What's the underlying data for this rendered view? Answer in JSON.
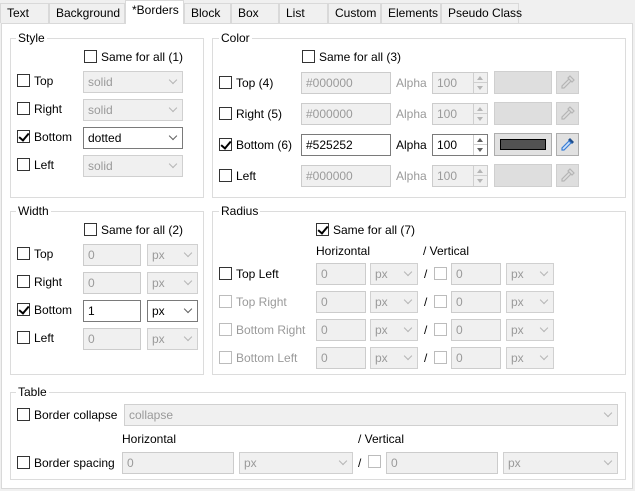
{
  "tabs": [
    "Text",
    "Background",
    "*Borders",
    "Block",
    "Box",
    "List",
    "Custom",
    "Elements",
    "Pseudo Class"
  ],
  "style": {
    "title": "Style",
    "same_for_all": "Same for all (1)",
    "rows": [
      {
        "label": "Top",
        "checked": false,
        "value": "solid",
        "enabled": false
      },
      {
        "label": "Right",
        "checked": false,
        "value": "solid",
        "enabled": false
      },
      {
        "label": "Bottom",
        "checked": true,
        "value": "dotted",
        "enabled": true
      },
      {
        "label": "Left",
        "checked": false,
        "value": "solid",
        "enabled": false
      }
    ]
  },
  "color": {
    "title": "Color",
    "same_for_all": "Same for all (3)",
    "alpha_label": "Alpha",
    "rows": [
      {
        "label": "Top (4)",
        "checked": false,
        "value": "#000000",
        "alpha": "100",
        "enabled": false
      },
      {
        "label": "Right (5)",
        "checked": false,
        "value": "#000000",
        "alpha": "100",
        "enabled": false
      },
      {
        "label": "Bottom (6)",
        "checked": true,
        "value": "#525252",
        "alpha": "100",
        "enabled": true
      },
      {
        "label": "Left",
        "checked": false,
        "value": "#000000",
        "alpha": "100",
        "enabled": false
      }
    ]
  },
  "width": {
    "title": "Width",
    "same_for_all": "Same for all (2)",
    "rows": [
      {
        "label": "Top",
        "checked": false,
        "value": "0",
        "unit": "px",
        "enabled": false
      },
      {
        "label": "Right",
        "checked": false,
        "value": "0",
        "unit": "px",
        "enabled": false
      },
      {
        "label": "Bottom",
        "checked": true,
        "value": "1",
        "unit": "px",
        "enabled": true
      },
      {
        "label": "Left",
        "checked": false,
        "value": "0",
        "unit": "px",
        "enabled": false
      }
    ]
  },
  "radius": {
    "title": "Radius",
    "same_for_all": "Same for all (7)",
    "horizontal": "Horizontal",
    "vertical": "/ Vertical",
    "slash": "/",
    "rows": [
      {
        "label": "Top Left",
        "enabled": true,
        "h_value": "0",
        "h_unit": "px",
        "v_value": "0",
        "v_unit": "px"
      },
      {
        "label": "Top Right",
        "enabled": false,
        "h_value": "0",
        "h_unit": "px",
        "v_value": "0",
        "v_unit": "px"
      },
      {
        "label": "Bottom Right",
        "enabled": false,
        "h_value": "0",
        "h_unit": "px",
        "v_value": "0",
        "v_unit": "px"
      },
      {
        "label": "Bottom Left",
        "enabled": false,
        "h_value": "0",
        "h_unit": "px",
        "v_value": "0",
        "v_unit": "px"
      }
    ]
  },
  "table": {
    "title": "Table",
    "border_collapse_label": "Border collapse",
    "border_collapse_value": "collapse",
    "horizontal": "Horizontal",
    "vertical": "/ Vertical",
    "slash": "/",
    "border_spacing_label": "Border spacing",
    "h_value": "0",
    "h_unit": "px",
    "v_value": "0",
    "v_unit": "px"
  },
  "colors": {
    "selected_swatch": "#525252",
    "picker_blue": "#3c7fd6"
  }
}
